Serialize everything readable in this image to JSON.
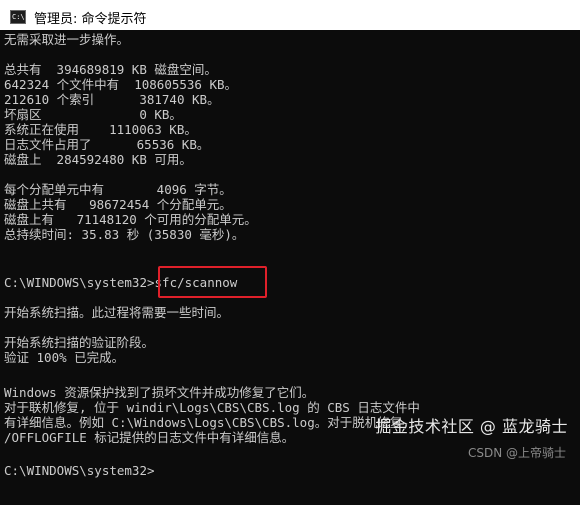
{
  "window": {
    "title": "管理员: 命令提示符",
    "icon_label": "C:\\"
  },
  "console": {
    "lines": [
      "无需采取进一步操作。",
      "",
      "总共有  394689819 KB 磁盘空间。",
      "642324 个文件中有  108605536 KB。",
      "212610 个索引      381740 KB。",
      "坏扇区             0 KB。",
      "系统正在使用    1110063 KB。",
      "日志文件占用了      65536 KB。",
      "磁盘上  284592480 KB 可用。",
      "",
      "每个分配单元中有       4096 字节。",
      "磁盘上共有   98672454 个分配单元。",
      "磁盘上有   71148120 个可用的分配单元。",
      "总持续时间: 35.83 秒 (35830 毫秒)。",
      "",
      "C:\\WINDOWS\\system32>sfc/scannow",
      "",
      "开始系统扫描。此过程将需要一些时间。",
      "",
      "开始系统扫描的验证阶段。",
      "验证 100% 已完成。",
      "",
      "Windows 资源保护找到了损坏文件并成功修复了它们。",
      "对于联机修复, 位于 windir\\Logs\\CBS\\CBS.log 的 CBS 日志文件中",
      "有详细信息。例如 C:\\Windows\\Logs\\CBS\\CBS.log。对于脱机修复,",
      "/OFFLOGFILE 标记提供的日志文件中有详细信息。",
      "",
      "C:\\WINDOWS\\system32>"
    ]
  },
  "watermark": {
    "main": "掘金技术社区 @ 蓝龙骑士",
    "sub": "CSDN @上帝骑士"
  },
  "colors": {
    "console_bg": "#0c0c0c",
    "console_fg": "#cccccc",
    "highlight": "#e0202a"
  }
}
